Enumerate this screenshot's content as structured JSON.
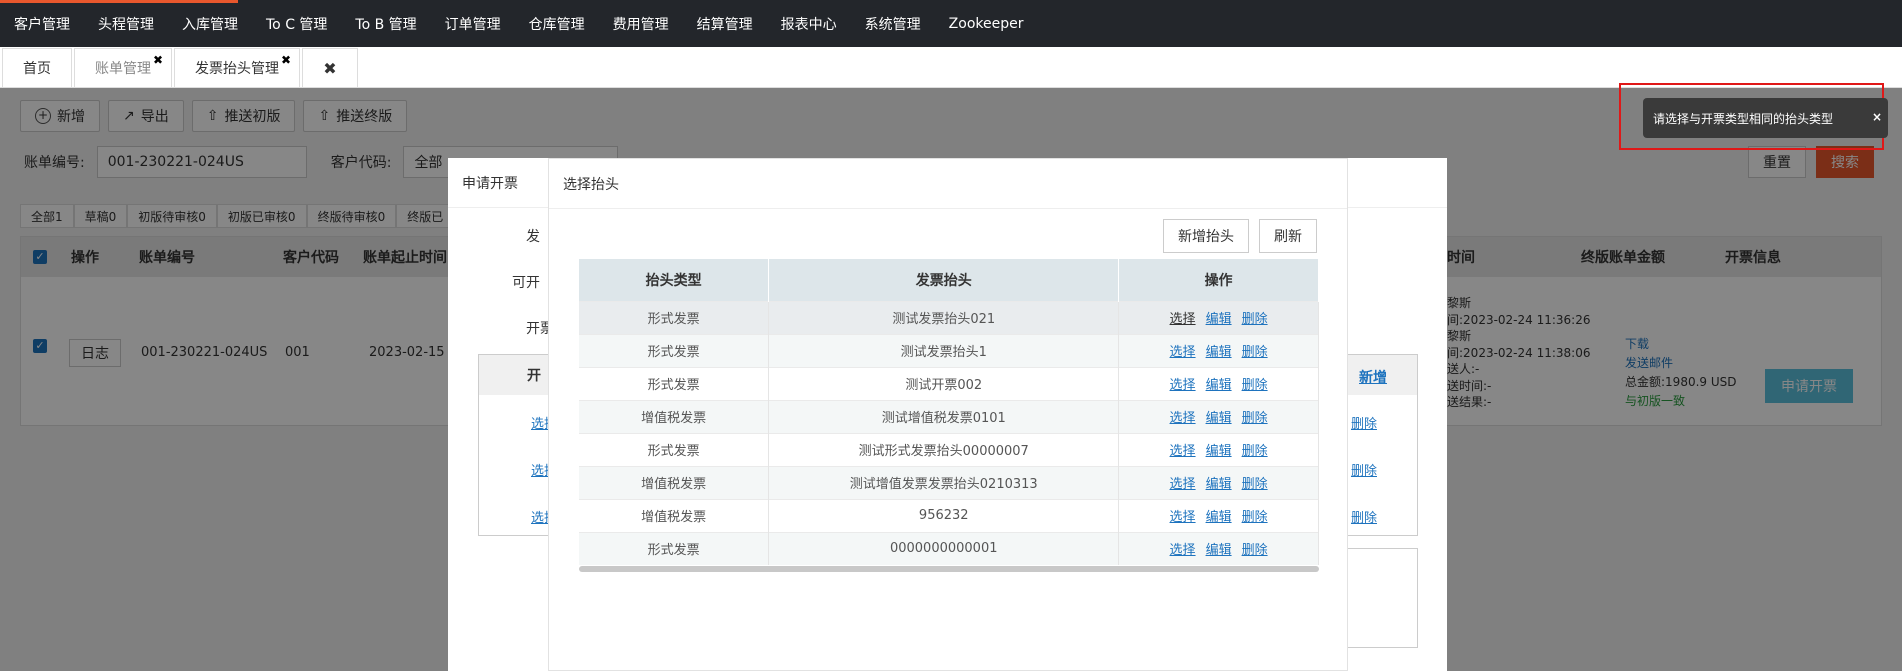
{
  "nav": [
    "客户管理",
    "头程管理",
    "入库管理",
    "To C 管理",
    "To B 管理",
    "订单管理",
    "仓库管理",
    "费用管理",
    "结算管理",
    "报表中心",
    "系统管理",
    "Zookeeper"
  ],
  "tabs": [
    {
      "label": "首页",
      "closable": false
    },
    {
      "label": "账单管理",
      "closable": true
    },
    {
      "label": "发票抬头管理",
      "closable": true
    }
  ],
  "close_all": "✖",
  "toolbar": {
    "add": "新增",
    "export": "导出",
    "push_initial": "推送初版",
    "push_final": "推送终版"
  },
  "filters": {
    "bill_no_label": "账单编号:",
    "bill_no_value": "001-230221-024US",
    "customer_label": "客户代码:",
    "customer_value": "全部",
    "reset": "重置",
    "search": "搜索"
  },
  "status_tabs": [
    "全部1",
    "草稿0",
    "初版待审核0",
    "初版已审核0",
    "终版待审核0",
    "终版已"
  ],
  "main_table": {
    "headers": [
      "操作",
      "账单编号",
      "客户代码",
      "账单起止时间",
      "账单时间",
      "终版账单金额",
      "开票信息"
    ],
    "row": {
      "log": "日志",
      "bill_no": "001-230221-024US",
      "customer": "001",
      "period": "2023-02-15 ~",
      "bill_time_lines": [
        "黎斯",
        "间:2023-02-24 11:36:26",
        "黎斯",
        "间:2023-02-24 11:38:06",
        "送人:-",
        "送时间:-",
        "送结果:-"
      ],
      "final_amount_lines": [
        "下载",
        "发送邮件",
        "总金额:1980.9 USD",
        "与初版一致"
      ],
      "apply_invoice": "申请开票"
    }
  },
  "modal_invoice": {
    "title": "申请开票",
    "labels": [
      "发",
      "可开",
      "开票"
    ],
    "sub_header": "开",
    "add_link": "新增",
    "row_links": [
      "选择",
      "选择",
      "选择"
    ],
    "delete_links": [
      "删除",
      "删除",
      "删除"
    ]
  },
  "modal_header": {
    "title": "选择抬头",
    "add_button": "新增抬头",
    "refresh_button": "刷新",
    "columns": [
      "抬头类型",
      "发票抬头",
      "操作"
    ],
    "rows": [
      {
        "type": "形式发票",
        "title": "测试发票抬头021"
      },
      {
        "type": "形式发票",
        "title": "测试发票抬头1"
      },
      {
        "type": "形式发票",
        "title": "测试开票002"
      },
      {
        "type": "增值税发票",
        "title": "测试增值税发票0101"
      },
      {
        "type": "形式发票",
        "title": "测试形式发票抬头00000007"
      },
      {
        "type": "增值税发票",
        "title": "测试增值发票发票抬头0210313"
      },
      {
        "type": "增值税发票",
        "title": "956232"
      },
      {
        "type": "形式发票",
        "title": "0000000000001"
      }
    ],
    "actions": {
      "select": "选择",
      "edit": "编辑",
      "delete": "删除"
    }
  },
  "toast": {
    "message": "请选择与开票类型相同的抬头类型",
    "close": "×"
  }
}
